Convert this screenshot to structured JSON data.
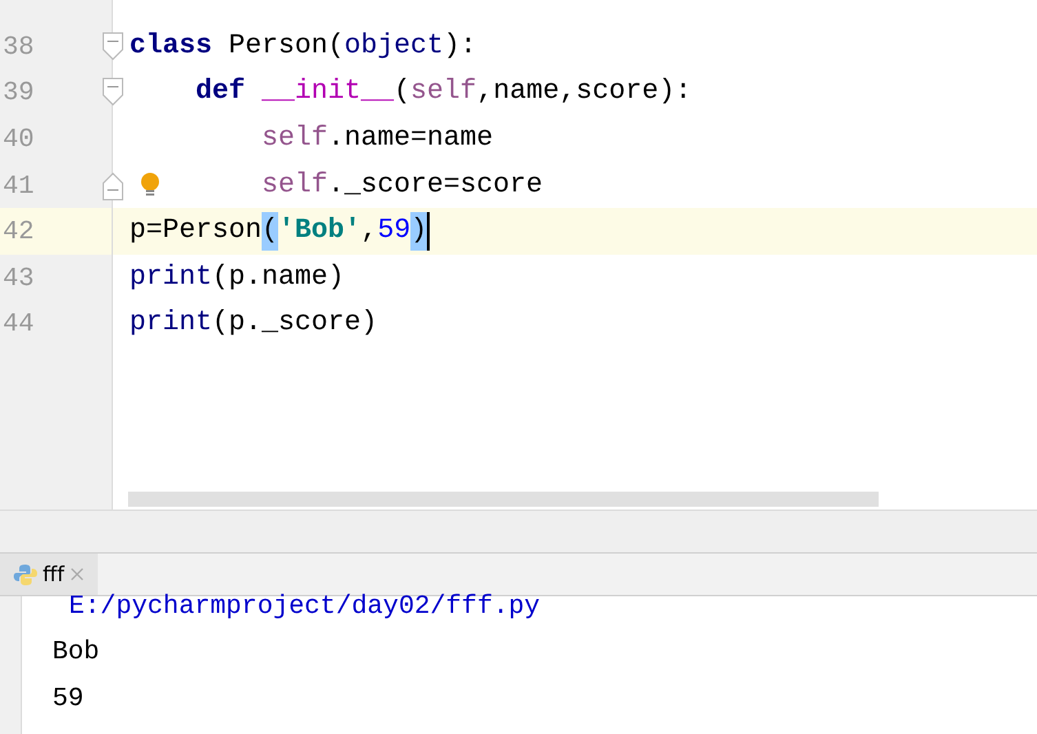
{
  "editor": {
    "lines": [
      {
        "number": "38",
        "fold_start": true,
        "fold_end": false,
        "bulb": false,
        "current": false,
        "tokens": [
          {
            "text": "class ",
            "kind": "keyword"
          },
          {
            "text": "Person(",
            "kind": "plain"
          },
          {
            "text": "object",
            "kind": "builtin"
          },
          {
            "text": "):",
            "kind": "plain"
          }
        ],
        "children": [
          {
            "number": "39",
            "fold_start": true,
            "fold_end": false,
            "bulb": false,
            "current": false,
            "tokens": [
              {
                "text": "def ",
                "kind": "keyword"
              },
              {
                "text": "__init__",
                "kind": "magic"
              },
              {
                "text": "(",
                "kind": "plain"
              },
              {
                "text": "self",
                "kind": "self"
              },
              {
                "text": ",name,score):",
                "kind": "plain"
              }
            ],
            "children": [
              {
                "number": "40",
                "fold_start": false,
                "fold_end": false,
                "bulb": false,
                "current": false,
                "tokens": [
                  {
                    "text": "self",
                    "kind": "self"
                  },
                  {
                    "text": ".name=name",
                    "kind": "plain"
                  }
                ]
              },
              {
                "number": "41",
                "fold_start": false,
                "fold_end": true,
                "bulb": true,
                "current": false,
                "tokens": [
                  {
                    "text": "self",
                    "kind": "self"
                  },
                  {
                    "text": "._score=score",
                    "kind": "plain"
                  }
                ]
              }
            ]
          }
        ]
      },
      {
        "number": "42",
        "fold_start": false,
        "fold_end": false,
        "bulb": false,
        "current": true,
        "tokens": [
          {
            "text": "p=Person",
            "kind": "plain"
          },
          {
            "text": "(",
            "kind": "brace"
          },
          {
            "text": "'Bob'",
            "kind": "string"
          },
          {
            "text": ",",
            "kind": "plain"
          },
          {
            "text": "59",
            "kind": "number"
          },
          {
            "text": ")",
            "kind": "brace"
          }
        ]
      },
      {
        "number": "43",
        "fold_start": false,
        "fold_end": false,
        "bulb": false,
        "current": false,
        "tokens": [
          {
            "text": "print",
            "kind": "builtin"
          },
          {
            "text": "(p.name)",
            "kind": "plain"
          }
        ]
      },
      {
        "number": "44",
        "fold_start": false,
        "fold_end": false,
        "bulb": false,
        "current": false,
        "tokens": [
          {
            "text": "print",
            "kind": "builtin"
          },
          {
            "text": "(p._score)",
            "kind": "plain"
          }
        ]
      }
    ]
  },
  "run_tabs": [
    {
      "label": "fff",
      "selected": true
    }
  ],
  "console": {
    "lines": [
      {
        "text": "E:/pycharmproject/day02/fff.py",
        "kind": "path"
      },
      {
        "text": "Bob",
        "kind": "output"
      },
      {
        "text": "59",
        "kind": "output"
      }
    ]
  }
}
